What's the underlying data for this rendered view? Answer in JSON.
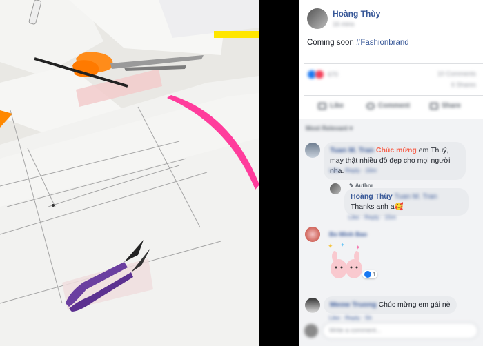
{
  "post": {
    "author": "Hoàng Thùy",
    "timestamp": "16 mins",
    "text_plain": "Coming soon ",
    "hashtag": "#Fashionbrand",
    "reaction_count": "670",
    "comment_count": "10 Comments",
    "share_count": "6 Shares"
  },
  "actions": {
    "like": "Like",
    "comment": "Comment",
    "share": "Share"
  },
  "sort": {
    "label": "Most Relevant ▾"
  },
  "comments": [
    {
      "author": "Tuan M. Tran",
      "highlight": "Chúc mừng",
      "text": " em Thuỷ, may thật nhiều đồ đẹp cho mọi người nha.",
      "meta": "Like · Reply · 16m"
    },
    {
      "badge": "Author",
      "author": "Hoàng Thùy",
      "mention": "Tuan M. Tran",
      "text": "Thanks anh a🥰",
      "meta": "Like · Reply · 15m"
    },
    {
      "author": "Bo Minh Bao",
      "sticker_reaction": "1",
      "meta": ""
    },
    {
      "author": "Meow Truong",
      "text": "Chúc mừng em gái nè",
      "meta": "Like · Reply · 5h"
    }
  ],
  "composer": {
    "placeholder": "Write a comment..."
  },
  "colors": {
    "link": "#385898",
    "highlight": "#f7614c",
    "pink_ruler": "#ff3c9c",
    "scissors_orange": "#ff8c1a",
    "thread_clipper": "#6b3fa0"
  }
}
